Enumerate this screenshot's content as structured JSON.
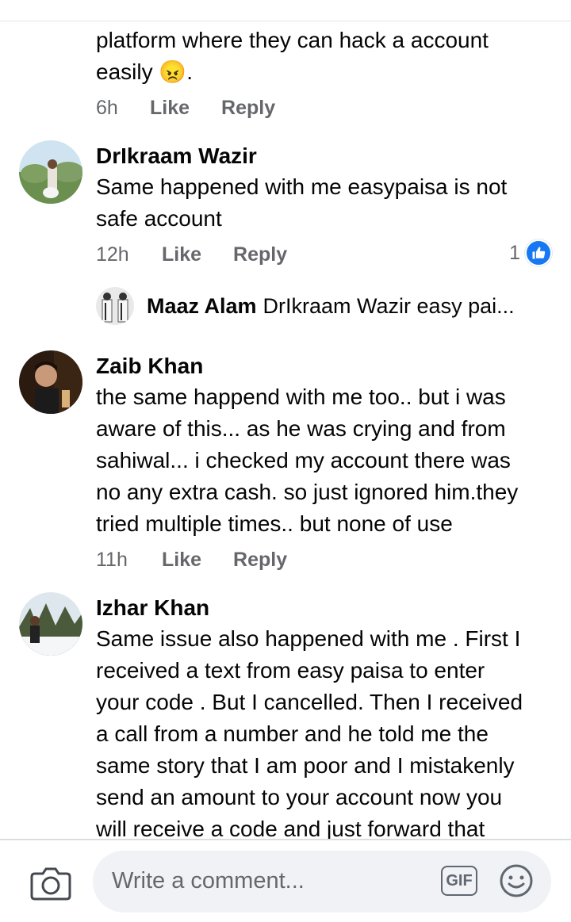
{
  "comments": [
    {
      "text_lines": [
        "platform where they can hack a account",
        "easily 😠."
      ],
      "time": "6h",
      "like": "Like",
      "reply": "Reply"
    },
    {
      "author": "DrIkraam Wazir",
      "text_lines": [
        "Same happened with me easypaisa is not",
        "safe account"
      ],
      "time": "12h",
      "like": "Like",
      "reply": "Reply",
      "reaction_count": "1",
      "reply_preview": {
        "author": "Maaz Alam",
        "text": "DrIkraam Wazir easy pai..."
      }
    },
    {
      "author": "Zaib Khan",
      "text_lines": [
        "the same happend with me too.. but i was",
        "aware of this... as he was crying and from",
        "sahiwal... i checked my account there was",
        "no any extra cash. so just ignored him.they",
        "tried multiple times.. but none of use"
      ],
      "time": "11h",
      "like": "Like",
      "reply": "Reply"
    },
    {
      "author": "Izhar Khan",
      "text_lines": [
        "Same issue also happened with me . First I",
        "received a text from easy paisa to enter",
        "your code . But I cancelled.  Then I received",
        "a call from a number and he told me the",
        "same story that I am poor and I mistakenly",
        "send an amount to your account now you",
        "will receive a code and just forward that"
      ]
    }
  ],
  "composer": {
    "placeholder": "Write a comment...",
    "gif_label": "GIF"
  },
  "colors": {
    "accent": "#1877f2",
    "meta": "#65676b",
    "input_bg": "#f0f2f5"
  }
}
